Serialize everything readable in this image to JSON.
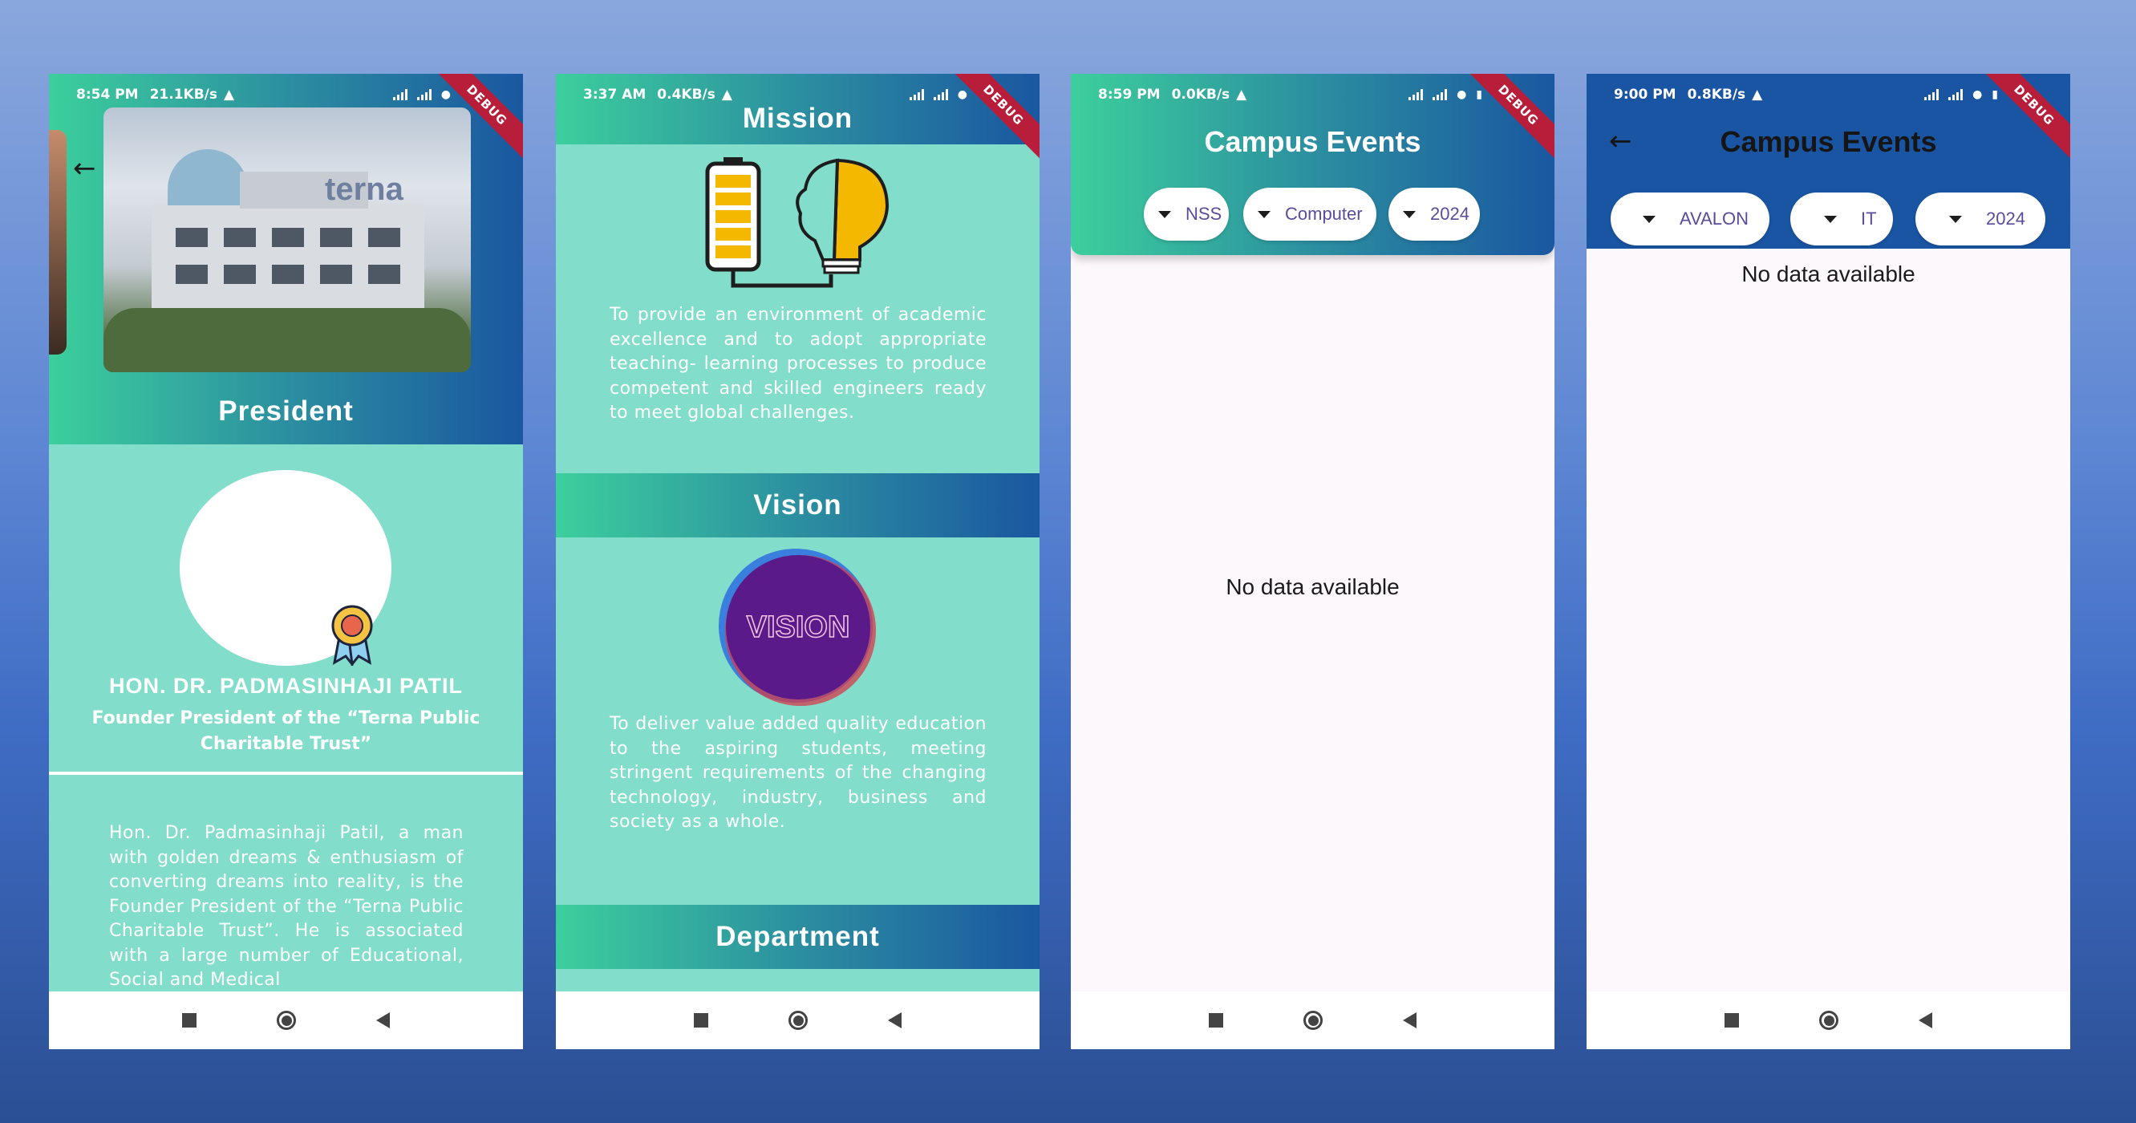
{
  "phones": [
    {
      "status": {
        "time": "8:54 PM",
        "speed": "21.1KB/s"
      },
      "debug": "DEBUG",
      "section_title": "President",
      "logo_text": "terna",
      "name": "HON. DR. PADMASINHAJI PATIL",
      "subtitle": "Founder President of the “Terna Public Charitable Trust”",
      "bio": "Hon. Dr. Padmasinhaji Patil, a man with golden dreams & enthusiasm of converting dreams into reality, is the Founder President of the “Terna Public Charitable Trust”. He is associated with a large number of Educational, Social and Medical"
    },
    {
      "status": {
        "time": "3:37 AM",
        "speed": "0.4KB/s"
      },
      "debug": "DEBUG",
      "mission_title": "Mission",
      "mission_text": "To provide an environment of academic excellence and to adopt appropriate teaching- learning processes to produce competent and skilled engineers ready to meet global challenges.",
      "vision_title": "Vision",
      "vision_logo_text": "VISION",
      "vision_text": "To deliver value added quality education to the aspiring students, meeting stringent requirements of the changing technology, industry, business and society as a whole.",
      "department_title": "Department"
    },
    {
      "status": {
        "time": "8:59 PM",
        "speed": "0.0KB/s"
      },
      "debug": "DEBUG",
      "title": "Campus Events",
      "filters": [
        "NSS",
        "Computer",
        "2024"
      ],
      "empty_text": "No data available"
    },
    {
      "status": {
        "time": "9:00 PM",
        "speed": "0.8KB/s"
      },
      "debug": "DEBUG",
      "title": "Campus Events",
      "filters": [
        "AVALON",
        "IT",
        "2024"
      ],
      "empty_text": "No data available"
    }
  ],
  "icons": [
    "back-arrow-icon",
    "signal-icon",
    "wifi-icon",
    "battery-icon",
    "alert-icon",
    "award-badge-icon",
    "battery-bulb-illustration",
    "vision-logo",
    "nav-recents-icon",
    "nav-home-icon",
    "nav-back-icon"
  ]
}
